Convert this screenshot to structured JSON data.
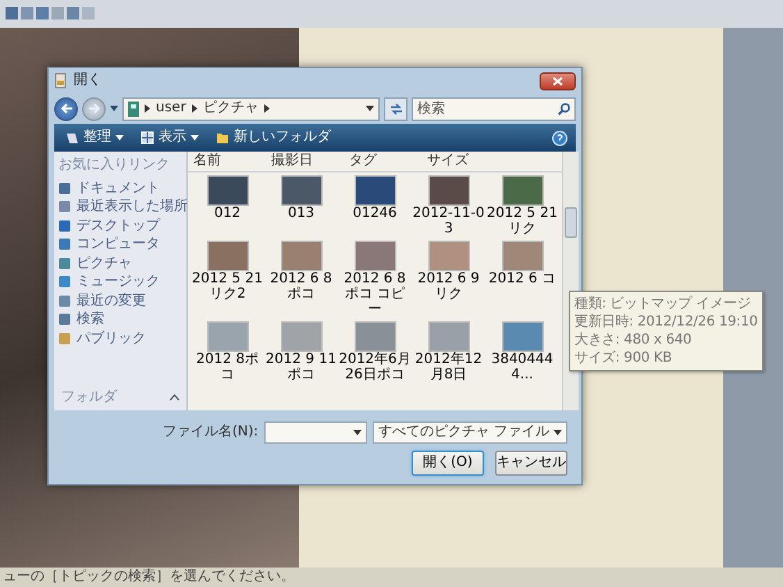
{
  "top_strip": {
    "swatches": [
      {
        "color": "#4f6f96"
      },
      {
        "color": "#7f95b2"
      },
      {
        "color": "#5d7ea6"
      },
      {
        "color": "#9aa8b8"
      },
      {
        "color": "#6c86a6"
      },
      {
        "color": "#aab6c4"
      }
    ]
  },
  "dialog": {
    "title": "開く",
    "address": {
      "segments": [
        "user",
        "ピクチャ"
      ]
    },
    "search": {
      "placeholder": "検索"
    },
    "toolbar": [
      {
        "label": "整理",
        "dropdown": true
      },
      {
        "label": "表示",
        "dropdown": true
      },
      {
        "label": "新しいフォルダ",
        "dropdown": false
      }
    ],
    "nav": {
      "header": "お気に入りリンク",
      "items": [
        {
          "label": "ドキュメント"
        },
        {
          "label": "最近表示した場所"
        },
        {
          "label": "デスクトップ"
        },
        {
          "label": "コンピュータ"
        },
        {
          "label": "ピクチャ"
        },
        {
          "label": "ミュージック"
        },
        {
          "label": "最近の変更"
        },
        {
          "label": "検索"
        },
        {
          "label": "パブリック"
        }
      ],
      "folders": {
        "label": "フォルダ",
        "expanded": false
      }
    },
    "columns": [
      "名前",
      "撮影日",
      "タグ",
      "サイズ"
    ],
    "files": [
      {
        "name": "012"
      },
      {
        "name": "013"
      },
      {
        "name": "01246"
      },
      {
        "name": "2012-11-03"
      },
      {
        "name": "2012 5 21リク"
      },
      {
        "name": "2012 5 21リク2"
      },
      {
        "name": "2012 6 8ポコ"
      },
      {
        "name": "2012 6 8ポコ コピー"
      },
      {
        "name": "2012 6 9リク"
      },
      {
        "name": "2012 6 コ"
      },
      {
        "name": "2012 8ポコ"
      },
      {
        "name": "2012 9 11ポコ"
      },
      {
        "name": "2012年6月26日ポコ"
      },
      {
        "name": "2012年12月8日"
      },
      {
        "name": "38404444..."
      }
    ],
    "tooltip": [
      "種類: ビットマップ イメージ",
      "更新日時: 2012/12/26 19:10",
      "大きさ: 480 x 640",
      "サイズ: 900 KB"
    ],
    "file_name": {
      "label": "ファイル名(N):"
    },
    "file_type": "すべてのピクチャ ファイル",
    "buttons": [
      "開く(O)",
      "キャンセル"
    ]
  },
  "status_text": "ューの［トピックの検索］を選んでください。"
}
